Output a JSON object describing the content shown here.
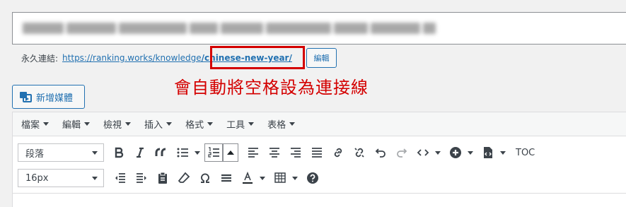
{
  "permalink": {
    "label": "永久連結:",
    "base_url": "https://ranking.works/knowledge",
    "slug": "/chinese-new-year/",
    "edit_label": "編輯"
  },
  "annotation": "會自動將空格設為連接線",
  "add_media_label": "新增媒體",
  "menubar": [
    "檔案",
    "編輯",
    "檢視",
    "插入",
    "格式",
    "工具",
    "表格"
  ],
  "toolbar": {
    "format_select": "段落",
    "fontsize_select": "16px",
    "toc_label": "TOC"
  },
  "colors": {
    "link": "#2271b1",
    "annotation": "#d40000"
  }
}
